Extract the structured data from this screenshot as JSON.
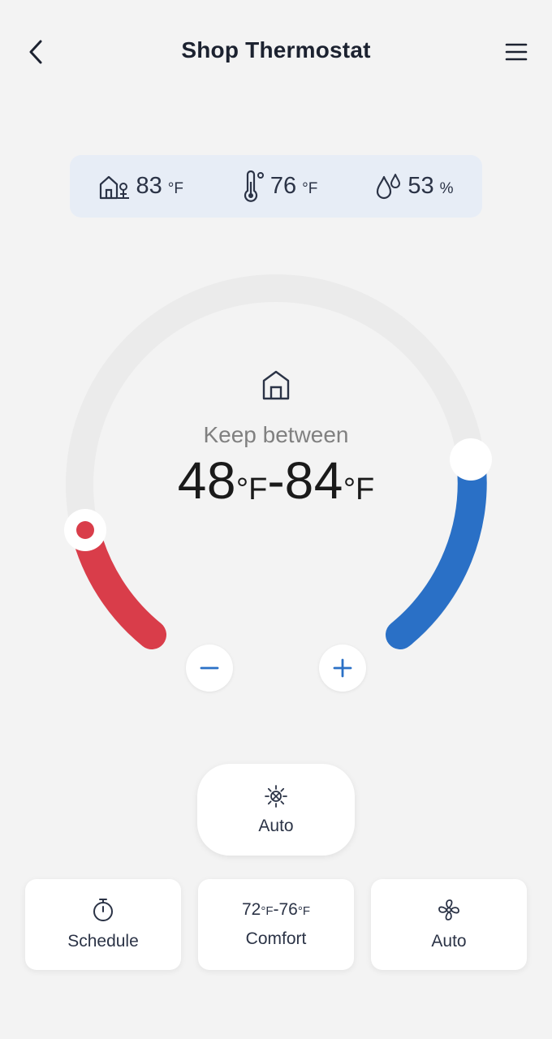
{
  "header": {
    "title": "Shop Thermostat"
  },
  "stats": {
    "outdoor": {
      "value": "83",
      "unit": "°F",
      "icon": "outdoor-home-icon"
    },
    "indoor": {
      "value": "76",
      "unit": "°F",
      "icon": "thermometer-icon"
    },
    "humidity": {
      "value": "53",
      "unit": "%",
      "icon": "humidity-drops-icon"
    }
  },
  "dial": {
    "label": "Keep between",
    "heat_setpoint": "48",
    "cool_setpoint": "84",
    "unit": "°F",
    "dash": "-",
    "heat_color": "#d93d4a",
    "cool_color": "#2a70c6",
    "track_color": "#ebebeb"
  },
  "controls": {
    "mode_label": "Auto",
    "schedule_label": "Schedule",
    "comfort_low": "72",
    "comfort_high": "76",
    "comfort_unit": "°F",
    "comfort_dash": "-",
    "comfort_label": "Comfort",
    "fan_label": "Auto"
  }
}
